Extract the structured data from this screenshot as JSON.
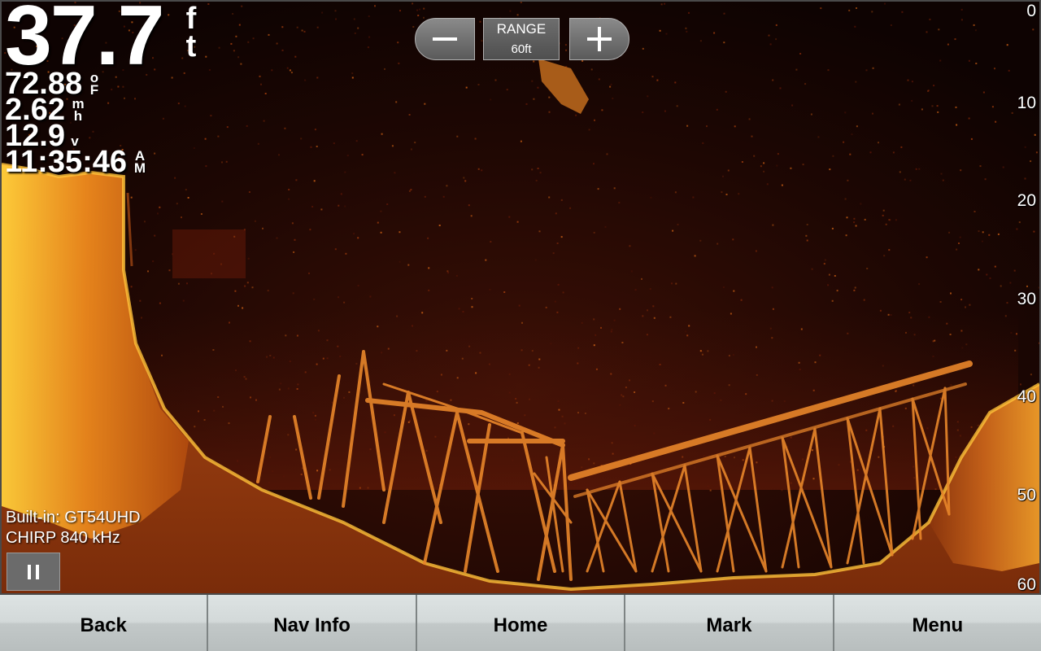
{
  "readouts": {
    "depth": "37.7",
    "depth_unit": [
      "f",
      "t"
    ],
    "temperature": "72.88",
    "temperature_unit": [
      "o",
      "F"
    ],
    "speed": "2.62",
    "speed_unit": [
      "m",
      "h"
    ],
    "voltage": "12.9",
    "voltage_unit": "v",
    "time": "11:35:46",
    "time_unit": [
      "A",
      "M"
    ]
  },
  "range": {
    "label": "RANGE",
    "value": "60ft",
    "zoom_out_icon": "minus-icon",
    "zoom_in_icon": "plus-icon"
  },
  "depth_scale": [
    "0",
    "10",
    "20",
    "30",
    "40",
    "50",
    "60"
  ],
  "source": {
    "transducer": "Built-in: GT54UHD",
    "frequency": "CHIRP 840 kHz"
  },
  "pause_icon": "pause-icon",
  "softkeys": [
    "Back",
    "Nav Info",
    "Home",
    "Mark",
    "Menu"
  ],
  "colors": {
    "sonar_background": "#100402",
    "sonar_bright": "#ffd24a",
    "sonar_mid": "#e0701a",
    "sonar_dark": "#5a1606",
    "softkey_bg": "#d3d9d9"
  }
}
